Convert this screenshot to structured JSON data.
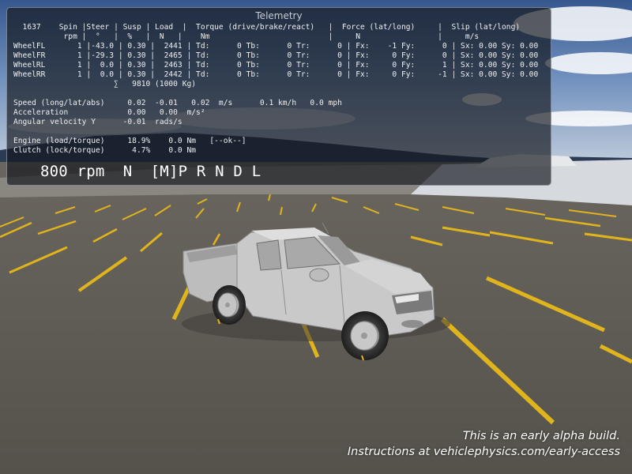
{
  "telemetry": {
    "title": "Telemetry",
    "header1": "  1637    Spin |Steer | Susp | Load  |  Torque (drive/brake/react)   |  Force (lat/long)     |  Slip (lat/long)",
    "header2": "           rpm |  °   |  %   |  N   |    Nm                          |     N                 |     m/s",
    "wheel_fl": "WheelFL       1 |-43.0 | 0.30 |  2441 | Td:      0 Tb:      0 Tr:      0 | Fx:    -1 Fy:      0 | Sx: 0.00 Sy: 0.00",
    "wheel_fr": "WheelFR       1 |-29.3 | 0.30 |  2465 | Td:      0 Tb:      0 Tr:      0 | Fx:     0 Fy:      0 | Sx: 0.00 Sy: 0.00",
    "wheel_rl": "WheelRL       1 |  0.0 | 0.30 |  2463 | Td:      0 Tb:      0 Tr:      0 | Fx:     0 Fy:      1 | Sx: 0.00 Sy: 0.00",
    "wheel_rr": "WheelRR       1 |  0.0 | 0.30 |  2442 | Td:      0 Tb:      0 Tr:      0 | Fx:     0 Fy:     -1 | Sx: 0.00 Sy: 0.00",
    "load_sum": "                      ∑   9810 (1000 Kg)",
    "speed": "Speed (long/lat/abs)     0.02  -0.01   0.02  m/s      0.1 km/h   0.0 mph",
    "acceleration": "Acceleration             0.00   0.00  m/s²",
    "angular_velocity": "Angular velocity Y      -0.01  rads/s",
    "engine": "Engine (load/torque)     18.9%    0.0 Nm   [--ok--]",
    "clutch": "Clutch (lock/torque)      4.7%    0.0 Nm",
    "gear_line": "800 rpm  N  [M]P R N D L"
  },
  "notice": {
    "line1": "This is an early alpha build.",
    "line2": "Instructions at vehiclephysics.com/early-access"
  },
  "colors": {
    "sky_top": "#3c5f98",
    "ground": "#5d5a54",
    "lane_marking": "#e0b41c",
    "vehicle": "#c8c8c8",
    "panel_bg": "#14181e"
  }
}
